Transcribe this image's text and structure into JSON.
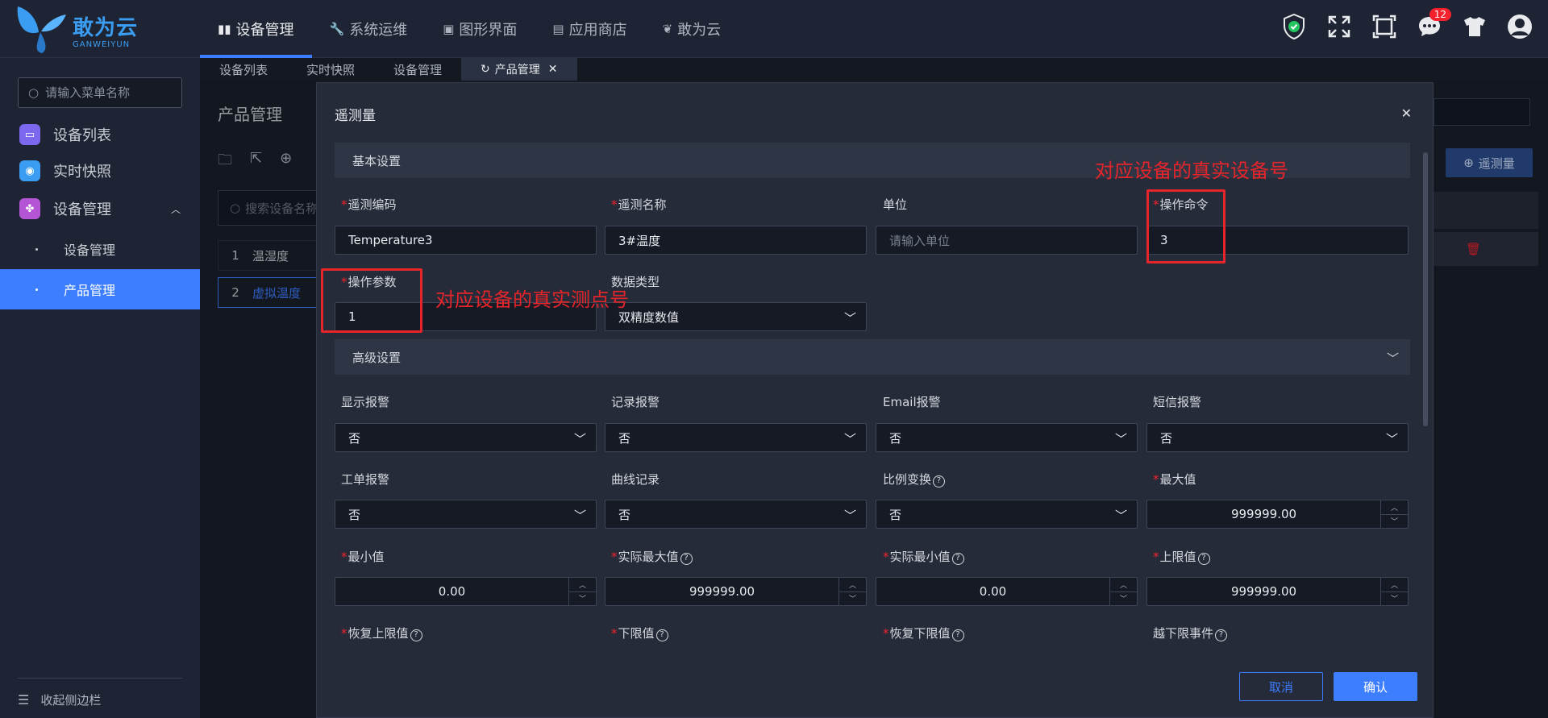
{
  "brand": {
    "name": "敢为云",
    "sub": "GANWEIYUN"
  },
  "topnav": [
    {
      "label": "设备管理",
      "icon": "device-icon"
    },
    {
      "label": "系统运维",
      "icon": "wrench-icon"
    },
    {
      "label": "图形界面",
      "icon": "monitor-icon"
    },
    {
      "label": "应用商店",
      "icon": "store-icon"
    },
    {
      "label": "敢为云",
      "icon": "butterfly-icon"
    }
  ],
  "notifications": {
    "count": "12"
  },
  "sidebar": {
    "search_placeholder": "请输入菜单名称",
    "items": [
      {
        "label": "设备列表",
        "color": "#7b68ee"
      },
      {
        "label": "实时快照",
        "color": "#3a9df2"
      },
      {
        "label": "设备管理",
        "color": "#b455d6"
      }
    ],
    "sub": [
      {
        "label": "设备管理"
      },
      {
        "label": "产品管理"
      }
    ],
    "collapse": "收起侧边栏"
  },
  "tabs": [
    {
      "label": "设备列表"
    },
    {
      "label": "实时快照"
    },
    {
      "label": "设备管理"
    },
    {
      "label": "产品管理"
    }
  ],
  "page": {
    "title": "产品管理",
    "search_placeholder": "搜索设备名称",
    "rows": [
      {
        "n": "1",
        "name": "温湿度"
      },
      {
        "n": "2",
        "name": "虚拟温度"
      }
    ],
    "add_button": "遥测量"
  },
  "modal": {
    "title": "遥测量",
    "basic_section": "基本设置",
    "advanced_section": "高级设置",
    "fields": {
      "code": {
        "label": "遥测编码",
        "value": "Temperature3"
      },
      "name": {
        "label": "遥测名称",
        "value": "3#温度"
      },
      "unit": {
        "label": "单位",
        "placeholder": "请输入单位"
      },
      "cmd": {
        "label": "操作命令",
        "value": "3"
      },
      "param": {
        "label": "操作参数",
        "value": "1"
      },
      "dtype": {
        "label": "数据类型",
        "value": "双精度数值"
      },
      "show_alarm": {
        "label": "显示报警",
        "value": "否"
      },
      "record_alarm": {
        "label": "记录报警",
        "value": "否"
      },
      "email_alarm": {
        "label": "Email报警",
        "value": "否"
      },
      "sms_alarm": {
        "label": "短信报警",
        "value": "否"
      },
      "ticket_alarm": {
        "label": "工单报警",
        "value": "否"
      },
      "curve": {
        "label": "曲线记录",
        "value": "否"
      },
      "scale": {
        "label": "比例变换",
        "value": "否"
      },
      "max": {
        "label": "最大值",
        "value": "999999.00"
      },
      "min": {
        "label": "最小值",
        "value": "0.00"
      },
      "real_max": {
        "label": "实际最大值",
        "value": "999999.00"
      },
      "real_min": {
        "label": "实际最小值",
        "value": "0.00"
      },
      "upper": {
        "label": "上限值",
        "value": "999999.00"
      },
      "restore_upper": {
        "label": "恢复上限值"
      },
      "lower": {
        "label": "下限值"
      },
      "restore_lower": {
        "label": "恢复下限值"
      },
      "lower_event": {
        "label": "越下限事件"
      }
    },
    "cancel": "取消",
    "confirm": "确认"
  },
  "annotations": {
    "device_no": "对应设备的真实设备号",
    "point_no": "对应设备的真实测点号",
    "color": "#e5252a"
  }
}
